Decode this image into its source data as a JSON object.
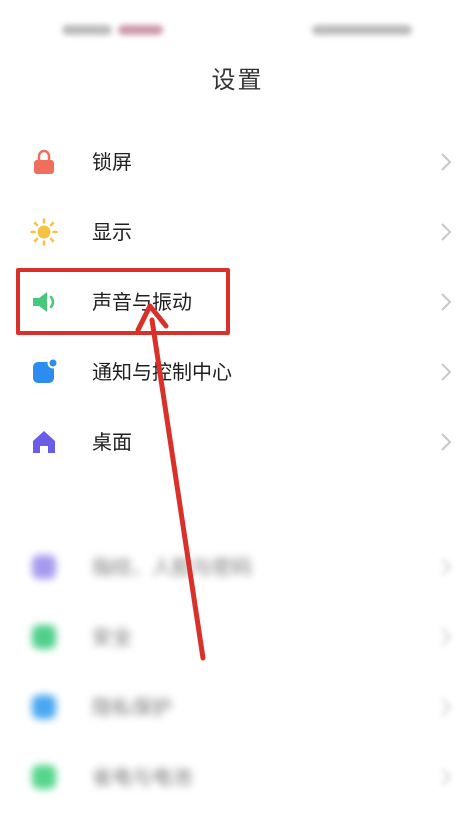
{
  "status_bar": {},
  "header": {
    "title": "设置"
  },
  "menu": {
    "items": [
      {
        "label": "锁屏",
        "icon": "lock-icon",
        "color": "#ef6f5c"
      },
      {
        "label": "显示",
        "icon": "sun-icon",
        "color": "#f6c242"
      },
      {
        "label": "声音与振动",
        "icon": "speaker-icon",
        "color": "#47c97b"
      },
      {
        "label": "通知与控制中心",
        "icon": "notification-icon",
        "color": "#2d8cf0"
      },
      {
        "label": "桌面",
        "icon": "home-icon",
        "color": "#6b5ce7"
      }
    ],
    "blurred_items": [
      {
        "label": "指纹、人脸与密码",
        "icon": "fingerprint-icon",
        "color": "#a69af0"
      },
      {
        "label": "安全",
        "icon": "shield-icon",
        "color": "#4fd08a"
      },
      {
        "label": "隐私保护",
        "icon": "privacy-icon",
        "color": "#4aa8f0"
      },
      {
        "label": "省电与电池",
        "icon": "battery-icon",
        "color": "#55d68c"
      }
    ]
  },
  "annotation": {
    "highlight_color": "#d9312a"
  }
}
